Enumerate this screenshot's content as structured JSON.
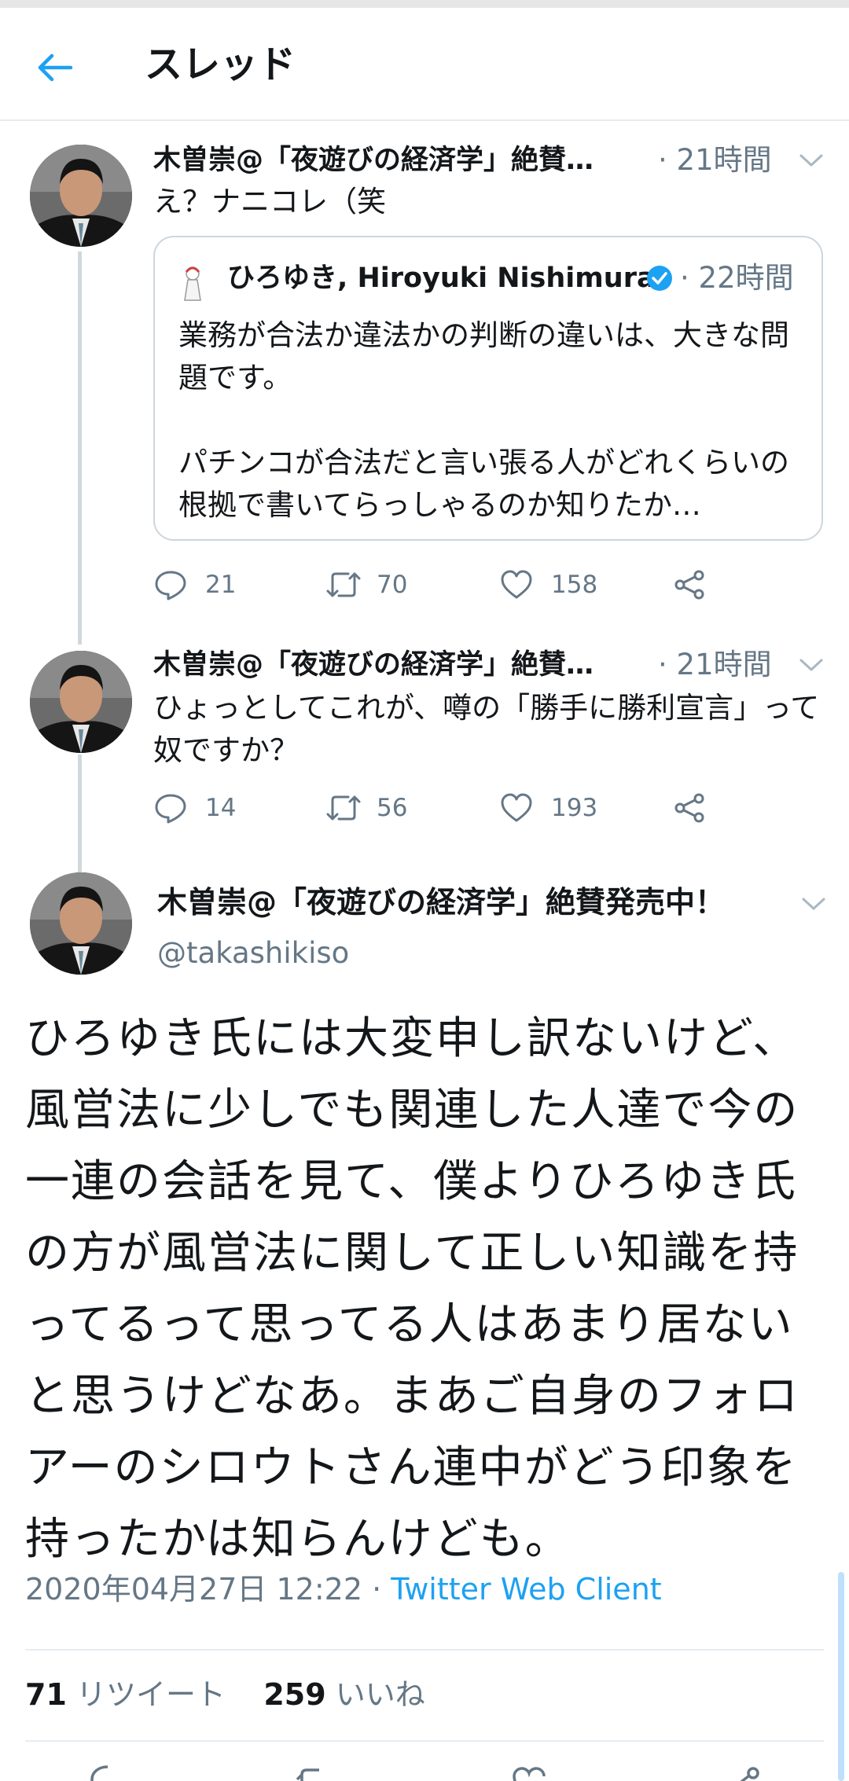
{
  "header": {
    "title": "スレッド"
  },
  "thread": [
    {
      "name": "木曽崇@「夜遊びの経済学」絶賛…",
      "time": "· 21時間",
      "text": "え？ナニコレ（笑",
      "quote": {
        "name": "ひろゆき, Hiroyuki Nishimura",
        "time": "· 22時間",
        "text": "業務が合法か違法かの判断の違いは、大きな問題です。\n\nパチンコが合法だと言い張る人がどれくらいの根拠で書いてらっしゃるのか知りたか…"
      },
      "replies": "21",
      "retweets": "70",
      "likes": "158"
    },
    {
      "name": "木曽崇@「夜遊びの経済学」絶賛…",
      "time": "· 21時間",
      "text": "ひょっとしてこれが、噂の「勝手に勝利宣言」って奴ですか？",
      "replies": "14",
      "retweets": "56",
      "likes": "193"
    }
  ],
  "main": {
    "name": "木曽崇@「夜遊びの経済学」絶賛発売中！",
    "handle": "@takashikiso",
    "text": "ひろゆき氏には大変申し訳ないけど、風営法に少しでも関連した人達で今の一連の会話を見て、僕よりひろゆき氏の方が風営法に関して正しい知識を持ってるって思ってる人はあまり居ないと思うけどなあ。まあご自身のフォロアーのシロウトさん連中がどう印象を持ったかは知らんけども。",
    "date": "2020年04月27日 12:22",
    "separator": "·",
    "client": "Twitter Web Client",
    "retweet_count": "71",
    "retweet_label": "リツイート",
    "like_count": "259",
    "like_label": "いいね"
  },
  "colors": {
    "accent": "#1da1f2",
    "secondary_text": "#657786",
    "thread_line": "#cfd9de"
  }
}
